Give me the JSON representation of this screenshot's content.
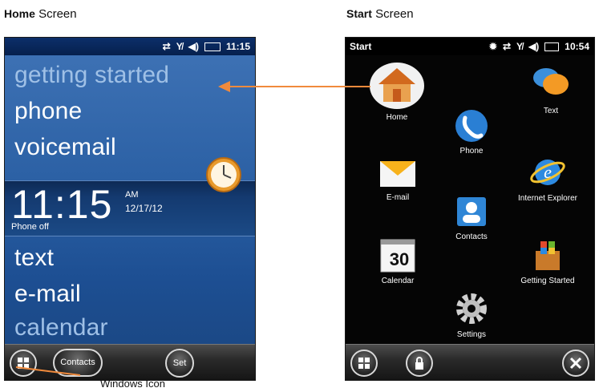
{
  "captions": {
    "home_bold": "Home",
    "home_rest": " Screen",
    "start_bold": "Start",
    "start_rest": " Screen"
  },
  "home_screen": {
    "status_time": "11:15",
    "menu": [
      "getting started",
      "phone",
      "voicemail"
    ],
    "clock": {
      "time": "11:15",
      "ampm": "AM",
      "date": "12/17/12",
      "status": "Phone off"
    },
    "menu_lower": [
      "text",
      "e-mail",
      "calendar"
    ],
    "softkeys": {
      "contacts": "Contacts",
      "set": "Set"
    }
  },
  "start_screen": {
    "title": "Start",
    "status_time": "10:54",
    "tiles": [
      "Home",
      "Text",
      "Phone",
      "E-mail",
      "Internet Explorer",
      "Contacts",
      "Calendar",
      "Getting Started",
      "Settings"
    ],
    "calendar_day": "30"
  },
  "annotations": {
    "windows_icon": "Windows Icon"
  },
  "colors": {
    "arrow": "#f08a3c",
    "home_bg": "#2a5fa3",
    "start_bg": "#050505"
  }
}
